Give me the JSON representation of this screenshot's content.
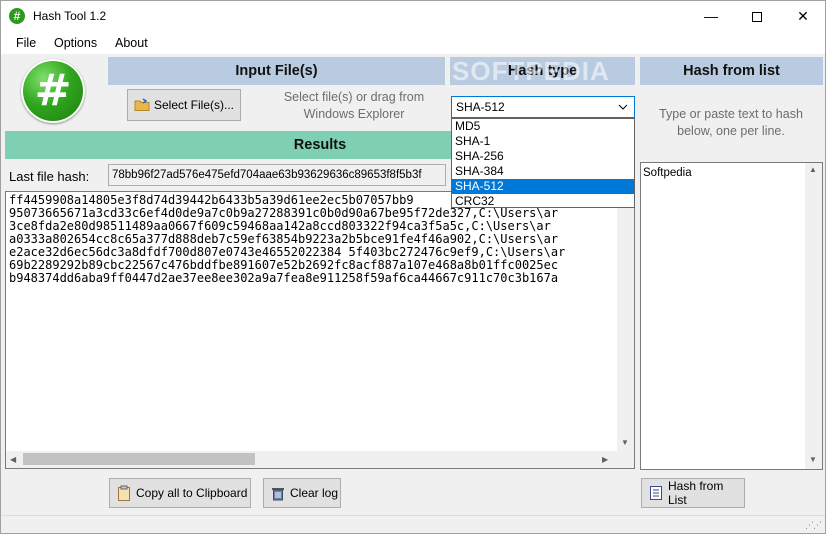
{
  "window": {
    "title": "Hash Tool 1.2",
    "icon_glyph": "#"
  },
  "controls": {
    "minimize": "—",
    "close": "✕"
  },
  "menu": {
    "items": [
      "File",
      "Options",
      "About"
    ]
  },
  "logo": {
    "glyph": "#"
  },
  "input_section": {
    "header": "Input File(s)",
    "select_button": "Select File(s)...",
    "hint_line1": "Select file(s) or drag from",
    "hint_line2": "Windows Explorer"
  },
  "hash_type": {
    "header": "Hash type",
    "watermark": "SOFTPEDIA",
    "selected": "SHA-512",
    "options": [
      "MD5",
      "SHA-1",
      "SHA-256",
      "SHA-384",
      "SHA-512",
      "CRC32"
    ]
  },
  "hash_list": {
    "header": "Hash from list",
    "hint_line1": "Type or paste text to hash",
    "hint_line2": "below, one per line.",
    "text": "Softpedia",
    "button": "Hash from List"
  },
  "results": {
    "header": "Results",
    "last_hash_label": "Last file hash:",
    "last_hash_value": "78bb96f27ad576e475efd704aae63b93629636c89653f8f5b3f",
    "log_lines": [
      "ff4459908a14805e3f8d74d39442b6433b5a39d61ee2ec5b07057bb9",
      "95073665671a3cd33c6ef4d0de9a7c0b9a27288391c0b0d90a67be95f72de327,C:\\Users\\ar",
      "3ce8fda2e80d98511489aa0667f609c59468aa142a8ccd803322f94ca3f5a5c,C:\\Users\\ar",
      "a0333a802654cc8c65a377d888deb7c59ef63854b9223a2b5bce91fe4f46a902,C:\\Users\\ar",
      "e2ace32d6ec56dc3a8dfdf700d807e0743e46552022384 5f403bc272476c9ef9,C:\\Users\\ar",
      "69b2289292b89cbc22567c476bddfbe891607e52b2692fc8acf887a107e468a8b01ffc0025ec",
      "b948374dd6aba9ff0447d2ae37ee8ee302a9a7fea8e911258f59af6ca44667c911c70c3b167a"
    ],
    "copy_button": "Copy all to Clipboard",
    "clear_button": "Clear log"
  }
}
